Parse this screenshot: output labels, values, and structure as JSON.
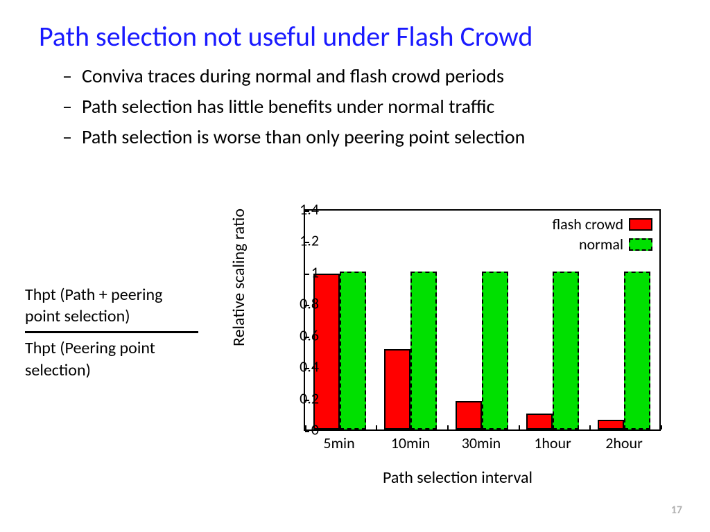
{
  "title": "Path selection not useful under Flash Crowd",
  "bullets": [
    "Conviva traces during normal and flash crowd periods",
    "Path selection has little benefits under normal traffic",
    "Path selection is worse than only peering point selection"
  ],
  "ratio": {
    "numerator": "Thpt (Path + peering point selection)",
    "denominator": "Thpt (Peering point selection)"
  },
  "legend": {
    "flash": "flash crowd",
    "normal": "normal"
  },
  "page_number": "17",
  "chart_data": {
    "type": "bar",
    "title": "",
    "xlabel": "Path selection interval",
    "ylabel": "Relative scaling ratio",
    "ylim": [
      0,
      1.4
    ],
    "yticks": [
      0,
      0.2,
      0.4,
      0.6,
      0.8,
      1,
      1.2,
      1.4
    ],
    "categories": [
      "5min",
      "10min",
      "30min",
      "1hour",
      "2hour"
    ],
    "series": [
      {
        "name": "flash crowd",
        "color": "#ff0000",
        "values": [
          0.99,
          0.51,
          0.18,
          0.1,
          0.06
        ]
      },
      {
        "name": "normal",
        "color": "#00e000",
        "values": [
          1.0,
          1.0,
          1.0,
          1.0,
          1.0
        ]
      }
    ],
    "legend_position": "top-right",
    "grid": false
  }
}
